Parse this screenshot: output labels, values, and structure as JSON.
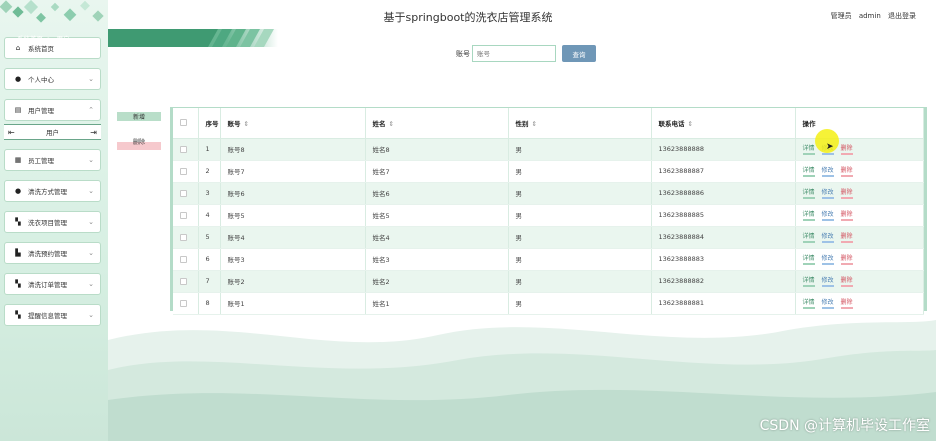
{
  "app": {
    "title": "基于springboot的洗衣店管理系统",
    "user_role": "管理员",
    "user_name": "admin",
    "logout_label": "退出登录"
  },
  "breadcrumb": {
    "home": "系统首页",
    "separator": ">",
    "current": "用户"
  },
  "sidebar": {
    "items": [
      {
        "label": "系统首页",
        "icon": "home-icon",
        "expandable": false
      },
      {
        "label": "个人中心",
        "icon": "person-icon",
        "expandable": true
      },
      {
        "label": "用户管理",
        "icon": "doc-icon",
        "expandable": true,
        "expanded": true,
        "sub": "用户"
      },
      {
        "label": "员工管理",
        "icon": "calendar-icon",
        "expandable": true
      },
      {
        "label": "清洗方式管理",
        "icon": "person-icon",
        "expandable": true
      },
      {
        "label": "洗衣项目管理",
        "icon": "grid-icon",
        "expandable": true
      },
      {
        "label": "清洗预约管理",
        "icon": "thumb-icon",
        "expandable": true
      },
      {
        "label": "清洗订单管理",
        "icon": "grid-icon",
        "expandable": true
      },
      {
        "label": "提醒信息管理",
        "icon": "grid-icon",
        "expandable": true
      }
    ]
  },
  "search": {
    "label": "账号",
    "placeholder": "账号",
    "button_label": "查询"
  },
  "actions": {
    "add_label": "新增",
    "delete_label": "删除"
  },
  "table": {
    "columns": [
      "",
      "序号",
      "账号",
      "姓名",
      "性别",
      "联系电话",
      "操作"
    ],
    "op_labels": {
      "detail": "详情",
      "edit": "修改",
      "delete": "删除"
    },
    "rows": [
      {
        "index": "1",
        "account": "账号8",
        "name": "姓名8",
        "gender": "男",
        "phone": "13623888888"
      },
      {
        "index": "2",
        "account": "账号7",
        "name": "姓名7",
        "gender": "男",
        "phone": "13623888887"
      },
      {
        "index": "3",
        "account": "账号6",
        "name": "姓名6",
        "gender": "男",
        "phone": "13623888886"
      },
      {
        "index": "4",
        "account": "账号5",
        "name": "姓名5",
        "gender": "男",
        "phone": "13623888885"
      },
      {
        "index": "5",
        "account": "账号4",
        "name": "姓名4",
        "gender": "男",
        "phone": "13623888884"
      },
      {
        "index": "6",
        "account": "账号3",
        "name": "姓名3",
        "gender": "男",
        "phone": "13623888883"
      },
      {
        "index": "7",
        "account": "账号2",
        "name": "姓名2",
        "gender": "男",
        "phone": "13623888882"
      },
      {
        "index": "8",
        "account": "账号1",
        "name": "姓名1",
        "gender": "男",
        "phone": "13623888881"
      }
    ]
  },
  "watermark": "CSDN @计算机毕设工作室",
  "colors": {
    "accent_green": "#3f9a72",
    "row_alt": "#eaf6ef",
    "search_button": "#6f97b7",
    "delete_red": "#d2505d",
    "edit_blue": "#4a7fb3"
  }
}
